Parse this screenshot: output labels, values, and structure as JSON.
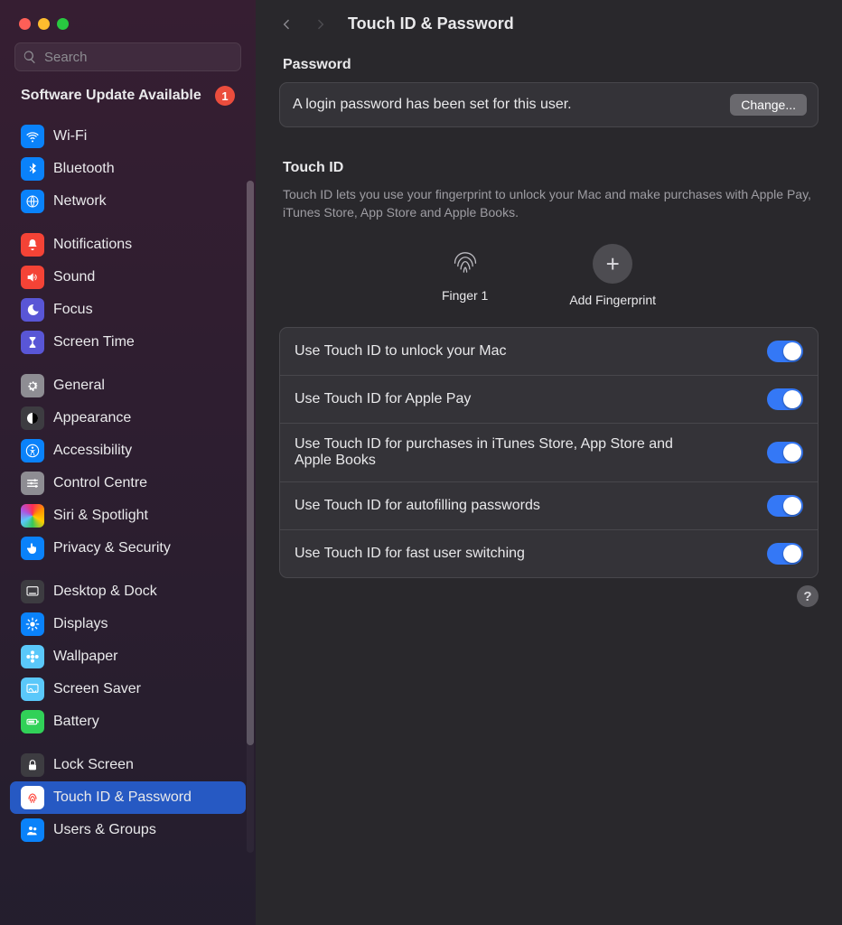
{
  "window": {
    "title": "Touch ID & Password"
  },
  "search": {
    "placeholder": "Search"
  },
  "update": {
    "text": "Software Update Available",
    "badge": "1"
  },
  "sidebar": {
    "groups": [
      {
        "items": [
          {
            "label": "Wi-Fi",
            "iconClass": "i-blue",
            "svg": "wifi"
          },
          {
            "label": "Bluetooth",
            "iconClass": "i-blue",
            "svg": "bluetooth"
          },
          {
            "label": "Network",
            "iconClass": "i-blue",
            "svg": "globe"
          }
        ]
      },
      {
        "items": [
          {
            "label": "Notifications",
            "iconClass": "i-red",
            "svg": "bell"
          },
          {
            "label": "Sound",
            "iconClass": "i-red",
            "svg": "speaker"
          },
          {
            "label": "Focus",
            "iconClass": "i-purple",
            "svg": "moon"
          },
          {
            "label": "Screen Time",
            "iconClass": "i-purple",
            "svg": "hourglass"
          }
        ]
      },
      {
        "items": [
          {
            "label": "General",
            "iconClass": "i-gray",
            "svg": "gear"
          },
          {
            "label": "Appearance",
            "iconClass": "i-dark",
            "svg": "appearance"
          },
          {
            "label": "Accessibility",
            "iconClass": "i-blue",
            "svg": "accessibility"
          },
          {
            "label": "Control Centre",
            "iconClass": "i-gray",
            "svg": "sliders"
          },
          {
            "label": "Siri & Spotlight",
            "iconClass": "i-siri",
            "svg": ""
          },
          {
            "label": "Privacy & Security",
            "iconClass": "i-blue",
            "svg": "hand"
          }
        ]
      },
      {
        "items": [
          {
            "label": "Desktop & Dock",
            "iconClass": "i-dark",
            "svg": "dock"
          },
          {
            "label": "Displays",
            "iconClass": "i-blue",
            "svg": "sun"
          },
          {
            "label": "Wallpaper",
            "iconClass": "i-cyan",
            "svg": "flower"
          },
          {
            "label": "Screen Saver",
            "iconClass": "i-cyan",
            "svg": "screensaver"
          },
          {
            "label": "Battery",
            "iconClass": "i-green",
            "svg": "battery"
          }
        ]
      },
      {
        "items": [
          {
            "label": "Lock Screen",
            "iconClass": "i-dark",
            "svg": "lock"
          },
          {
            "label": "Touch ID & Password",
            "iconClass": "i-white",
            "svg": "fingerprint",
            "selected": true
          },
          {
            "label": "Users & Groups",
            "iconClass": "i-blue",
            "svg": "users"
          }
        ]
      }
    ]
  },
  "main": {
    "passwordTitle": "Password",
    "passwordDesc": "A login password has been set for this user.",
    "changeBtn": "Change...",
    "touchIdTitle": "Touch ID",
    "touchIdDesc": "Touch ID lets you use your fingerprint to unlock your Mac and make purchases with Apple Pay, iTunes Store, App Store and Apple Books.",
    "fingerprints": {
      "existing": "Finger 1",
      "add": "Add Fingerprint"
    },
    "toggles": [
      {
        "label": "Use Touch ID to unlock your Mac",
        "on": true
      },
      {
        "label": "Use Touch ID for Apple Pay",
        "on": true
      },
      {
        "label": "Use Touch ID for purchases in iTunes Store, App Store and Apple Books",
        "on": true
      },
      {
        "label": "Use Touch ID for autofilling passwords",
        "on": true
      },
      {
        "label": "Use Touch ID for fast user switching",
        "on": true
      }
    ],
    "help": "?"
  }
}
